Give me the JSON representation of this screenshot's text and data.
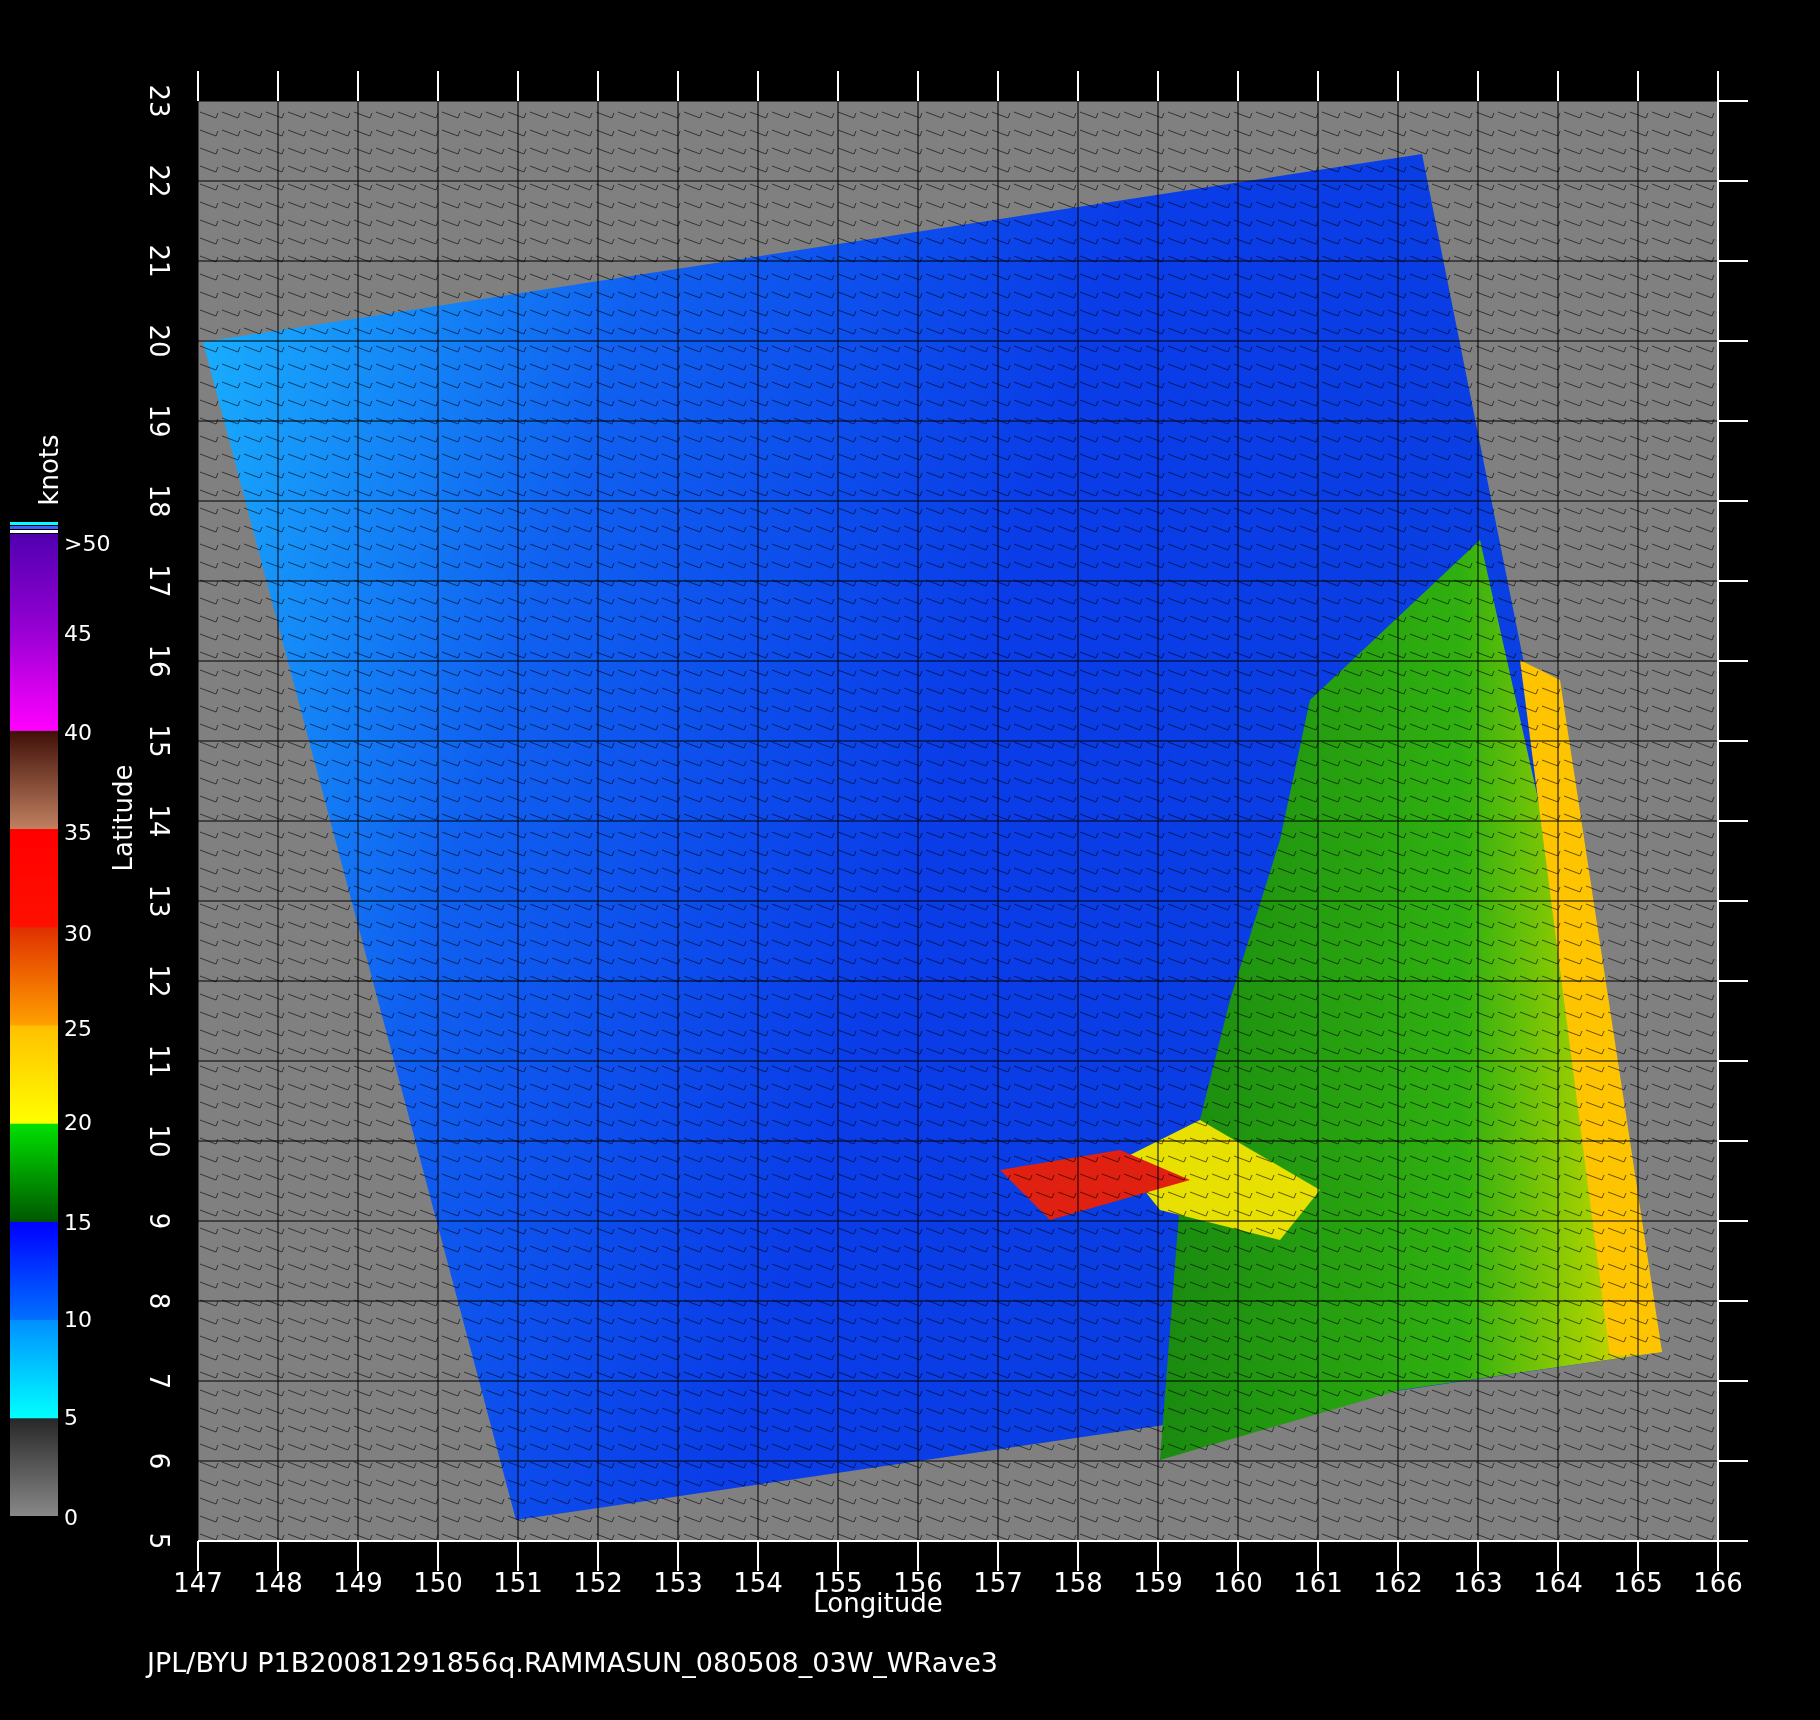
{
  "x_axis": {
    "label": "Longitude",
    "ticks": [
      "147",
      "148",
      "149",
      "150",
      "151",
      "152",
      "153",
      "154",
      "155",
      "156",
      "157",
      "158",
      "159",
      "160",
      "161",
      "162",
      "163",
      "164",
      "165",
      "166"
    ]
  },
  "y_axis": {
    "label": "Latitude",
    "ticks": [
      "5",
      "6",
      "7",
      "8",
      "9",
      "10",
      "11",
      "12",
      "13",
      "14",
      "15",
      "16",
      "17",
      "18",
      "19",
      "20",
      "21",
      "22",
      "23"
    ]
  },
  "colorbar": {
    "title": "knots",
    "labels": [
      ">50",
      "45",
      "40",
      "35",
      "30",
      "25",
      "20",
      "15",
      "10",
      "5",
      "0"
    ]
  },
  "caption": "JPL/BYU  P1B20081291856q.RAMMASUN_080508_03W_WRave3"
}
